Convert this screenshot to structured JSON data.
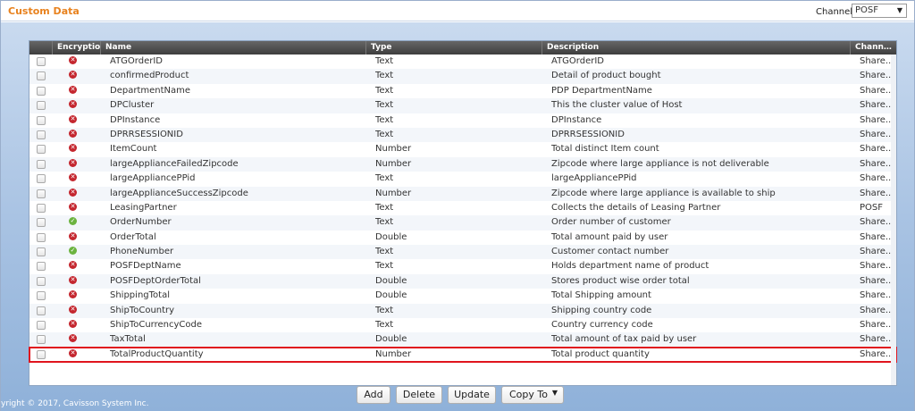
{
  "header": {
    "title": "Custom Data",
    "channel_label": "Channel",
    "channel_value": "POSF"
  },
  "grid": {
    "columns": [
      "Encryptio…",
      "Name",
      "Type",
      "Description",
      "Chann…"
    ],
    "rows": [
      {
        "encrypted": false,
        "name": "ATGOrderID",
        "type": "Text",
        "description": "ATGOrderID",
        "channel": "Share..."
      },
      {
        "encrypted": false,
        "name": "confirmedProduct",
        "type": "Text",
        "description": "Detail of product bought",
        "channel": "Share..."
      },
      {
        "encrypted": false,
        "name": "DepartmentName",
        "type": "Text",
        "description": "PDP DepartmentName",
        "channel": "Share..."
      },
      {
        "encrypted": false,
        "name": "DPCluster",
        "type": "Text",
        "description": "This the cluster value of Host",
        "channel": "Share..."
      },
      {
        "encrypted": false,
        "name": "DPInstance",
        "type": "Text",
        "description": "DPInstance",
        "channel": "Share..."
      },
      {
        "encrypted": false,
        "name": "DPRRSESSIONID",
        "type": "Text",
        "description": "DPRRSESSIONID",
        "channel": "Share..."
      },
      {
        "encrypted": false,
        "name": "ItemCount",
        "type": "Number",
        "description": "Total distinct Item count",
        "channel": "Share..."
      },
      {
        "encrypted": false,
        "name": "largeApplianceFailedZipcode",
        "type": "Number",
        "description": "Zipcode where large appliance is not deliverable",
        "channel": "Share..."
      },
      {
        "encrypted": false,
        "name": "largeAppliancePPid",
        "type": "Text",
        "description": "largeAppliancePPid",
        "channel": "Share..."
      },
      {
        "encrypted": false,
        "name": "largeApplianceSuccessZipcode",
        "type": "Number",
        "description": "Zipcode where large appliance is available to ship",
        "channel": "Share..."
      },
      {
        "encrypted": false,
        "name": "LeasingPartner",
        "type": "Text",
        "description": "Collects the details of Leasing Partner",
        "channel": "POSF"
      },
      {
        "encrypted": true,
        "name": "OrderNumber",
        "type": "Text",
        "description": "Order number of customer",
        "channel": "Share..."
      },
      {
        "encrypted": false,
        "name": "OrderTotal",
        "type": "Double",
        "description": "Total amount paid by user",
        "channel": "Share..."
      },
      {
        "encrypted": true,
        "name": "PhoneNumber",
        "type": "Text",
        "description": "Customer contact number",
        "channel": "Share..."
      },
      {
        "encrypted": false,
        "name": "POSFDeptName",
        "type": "Text",
        "description": "Holds department name of product",
        "channel": "Share..."
      },
      {
        "encrypted": false,
        "name": "POSFDeptOrderTotal",
        "type": "Double",
        "description": "Stores product wise order total",
        "channel": "Share..."
      },
      {
        "encrypted": false,
        "name": "ShippingTotal",
        "type": "Double",
        "description": "Total Shipping amount",
        "channel": "Share..."
      },
      {
        "encrypted": false,
        "name": "ShipToCountry",
        "type": "Text",
        "description": "Shipping country code",
        "channel": "Share..."
      },
      {
        "encrypted": false,
        "name": "ShipToCurrencyCode",
        "type": "Text",
        "description": "Country currency code",
        "channel": "Share..."
      },
      {
        "encrypted": false,
        "name": "TaxTotal",
        "type": "Double",
        "description": "Total amount of tax paid by user",
        "channel": "Share..."
      },
      {
        "encrypted": false,
        "name": "TotalProductQuantity",
        "type": "Number",
        "description": "Total product quantity",
        "channel": "Share...",
        "highlighted": true
      }
    ]
  },
  "buttons": {
    "add": "Add",
    "delete": "Delete",
    "update": "Update",
    "copy_to": "Copy To"
  },
  "footer": {
    "copyright": "yright © 2017, Cavisson System Inc."
  }
}
